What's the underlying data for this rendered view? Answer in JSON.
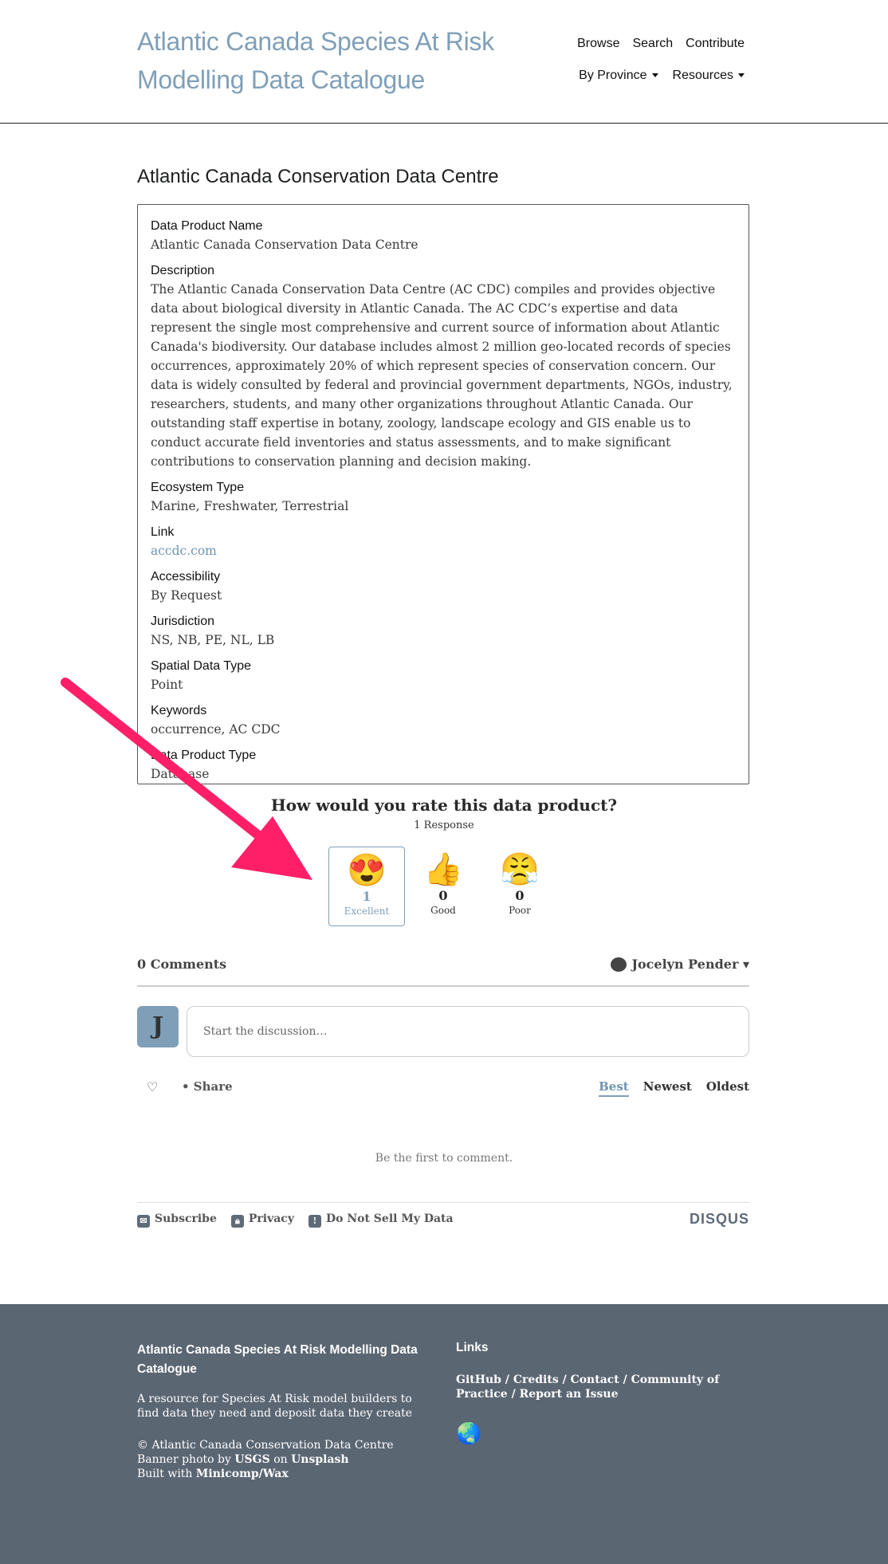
{
  "header": {
    "site_title": "Atlantic Canada Species At Risk Modelling Data Catalogue",
    "nav_browse": "Browse",
    "nav_search": "Search",
    "nav_contribute": "Contribute",
    "nav_by_province": "By Province",
    "nav_resources": "Resources"
  },
  "page": {
    "title": "Atlantic Canada Conservation Data Centre"
  },
  "fields": [
    {
      "label": "Data Product Name",
      "value": "Atlantic Canada Conservation Data Centre"
    },
    {
      "label": "Description",
      "value": "The Atlantic Canada Conservation Data Centre (AC CDC) compiles and provides objective data about biological diversity in Atlantic Canada. The AC CDC’s expertise and data represent the single most comprehensive and current source of information about Atlantic Canada's biodiversity. Our database includes almost 2 million geo-located records of species occurrences, approximately 20% of which represent species of conservation concern. Our data is widely consulted by federal and provincial government departments, NGOs, industry, researchers, students, and many other organizations throughout Atlantic Canada. Our outstanding staff expertise in botany, zoology, landscape ecology and GIS enable us to conduct accurate field inventories and status assessments, and to make significant contributions to conservation planning and decision making."
    },
    {
      "label": "Ecosystem Type",
      "value": "Marine, Freshwater, Terrestrial"
    },
    {
      "label": "Link",
      "value": "accdc.com"
    },
    {
      "label": "Accessibility",
      "value": "By Request"
    },
    {
      "label": "Jurisdiction",
      "value": "NS, NB, PE, NL, LB"
    },
    {
      "label": "Spatial Data Type",
      "value": "Point"
    },
    {
      "label": "Keywords",
      "value": "occurrence, AC CDC"
    },
    {
      "label": "Data Product Type",
      "value": "Database"
    }
  ],
  "rating": {
    "question": "How would you rate this data product?",
    "responses": "1 Response",
    "reactions": [
      {
        "emoji": "😍",
        "count": "1",
        "label": "Excellent",
        "selected": true
      },
      {
        "emoji": "👍",
        "count": "0",
        "label": "Good",
        "selected": false
      },
      {
        "emoji": "😤",
        "count": "0",
        "label": "Poor",
        "selected": false
      }
    ]
  },
  "comments": {
    "count": "0 Comments",
    "user": "Jocelyn Pender ▾",
    "avatar_letter": "J",
    "placeholder": "Start the discussion…",
    "share": "• Share",
    "sort_best": "Best",
    "sort_newest": "Newest",
    "sort_oldest": "Oldest",
    "empty": "Be the first to comment.",
    "subscribe": "Subscribe",
    "privacy": "Privacy",
    "do_not_sell": "Do Not Sell My Data",
    "disqus": "DISQUS"
  },
  "footer": {
    "title": "Atlantic Canada Species At Risk Modelling Data Catalogue",
    "tagline": "A resource for Species At Risk model builders to find data they need and deposit data they create",
    "copyright": "© Atlantic Canada Conservation Data Centre",
    "banner_prefix": "Banner photo by",
    "banner_usgs": "USGS",
    "banner_on": "on",
    "banner_unsplash": "Unsplash",
    "built_prefix": "Built with",
    "built_with": "Minicomp/Wax",
    "links_head": "Links",
    "link_github": "GitHub",
    "link_credits": "Credits",
    "link_contact": "Contact",
    "link_cop": "Community of Practice",
    "link_issue": "Report an Issue",
    "sep": " / "
  },
  "colors": {
    "accent": "#7f9fb8",
    "annotation_arrow": "#ff1f68",
    "footer_bg": "#5b6673"
  }
}
